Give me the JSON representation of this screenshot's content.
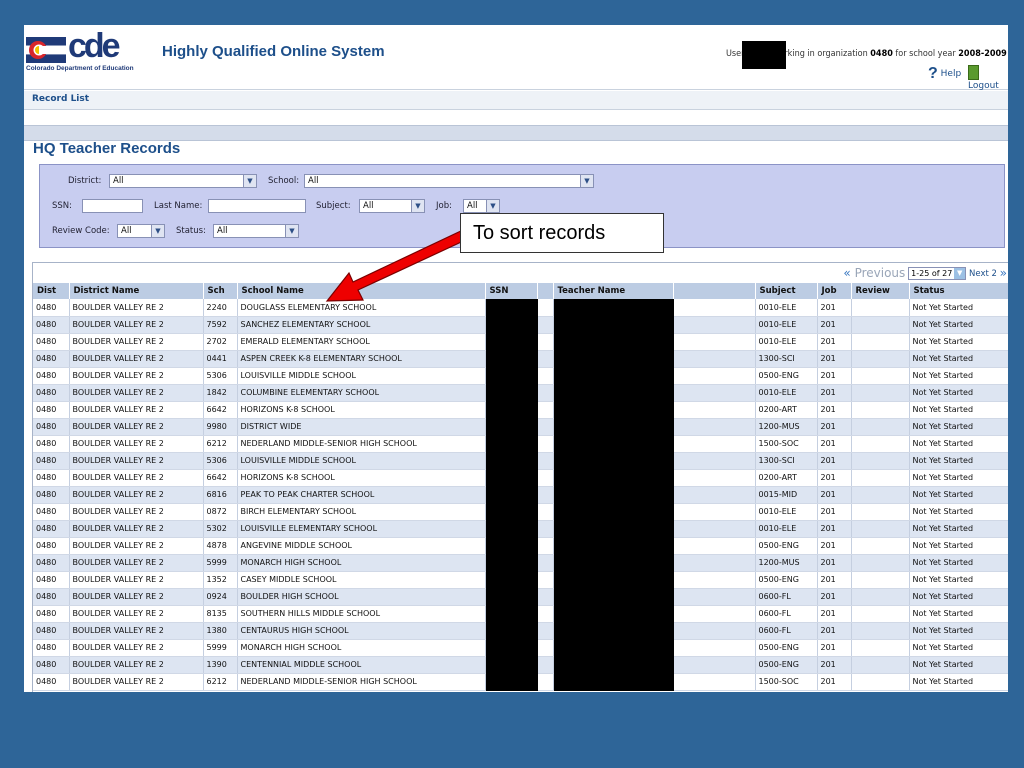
{
  "header": {
    "org_name": "Colorado Department of Education",
    "logo_text": "cde",
    "app_title": "Highly Qualified Online System",
    "user_prefix": "User",
    "user_mid": "working in organization",
    "org_code": "0480",
    "year_prefix": "for school year",
    "school_year": "2008-2009",
    "help": "Help",
    "logout": "Logout"
  },
  "nav": {
    "record_list": "Record List"
  },
  "page": {
    "title": "HQ Teacher Records"
  },
  "filters": {
    "district_label": "District:",
    "district_value": "All",
    "school_label": "School:",
    "school_value": "All",
    "ssn_label": "SSN:",
    "lastname_label": "Last Name:",
    "subject_label": "Subject:",
    "subject_value": "All",
    "job_label": "Job:",
    "job_value": "All",
    "review_label": "Review Code:",
    "review_value": "All",
    "status_label": "Status:",
    "status_value": "All"
  },
  "callout": {
    "text": "To sort records"
  },
  "pager": {
    "previous": "Previous",
    "range": "1-25 of 27",
    "next": "Next 2"
  },
  "table": {
    "columns": [
      "Dist",
      "District Name",
      "Sch",
      "School Name",
      "SSN",
      "",
      "Teacher Name",
      "",
      "Subject",
      "Job",
      "Review",
      "Status"
    ],
    "rows": [
      [
        "0480",
        "BOULDER VALLEY RE 2",
        "2240",
        "DOUGLASS ELEMENTARY SCHOOL",
        "0010-ELE",
        "201",
        "",
        "Not Yet Started"
      ],
      [
        "0480",
        "BOULDER VALLEY RE 2",
        "7592",
        "SANCHEZ ELEMENTARY SCHOOL",
        "0010-ELE",
        "201",
        "",
        "Not Yet Started"
      ],
      [
        "0480",
        "BOULDER VALLEY RE 2",
        "2702",
        "EMERALD ELEMENTARY SCHOOL",
        "0010-ELE",
        "201",
        "",
        "Not Yet Started"
      ],
      [
        "0480",
        "BOULDER VALLEY RE 2",
        "0441",
        "ASPEN CREEK K-8 ELEMENTARY SCHOOL",
        "1300-SCI",
        "201",
        "",
        "Not Yet Started"
      ],
      [
        "0480",
        "BOULDER VALLEY RE 2",
        "5306",
        "LOUISVILLE MIDDLE SCHOOL",
        "0500-ENG",
        "201",
        "",
        "Not Yet Started"
      ],
      [
        "0480",
        "BOULDER VALLEY RE 2",
        "1842",
        "COLUMBINE ELEMENTARY SCHOOL",
        "0010-ELE",
        "201",
        "",
        "Not Yet Started"
      ],
      [
        "0480",
        "BOULDER VALLEY RE 2",
        "6642",
        "HORIZONS K-8 SCHOOL",
        "0200-ART",
        "201",
        "",
        "Not Yet Started"
      ],
      [
        "0480",
        "BOULDER VALLEY RE 2",
        "9980",
        "DISTRICT WIDE",
        "1200-MUS",
        "201",
        "",
        "Not Yet Started"
      ],
      [
        "0480",
        "BOULDER VALLEY RE 2",
        "6212",
        "NEDERLAND MIDDLE-SENIOR HIGH SCHOOL",
        "1500-SOC",
        "201",
        "",
        "Not Yet Started"
      ],
      [
        "0480",
        "BOULDER VALLEY RE 2",
        "5306",
        "LOUISVILLE MIDDLE SCHOOL",
        "1300-SCI",
        "201",
        "",
        "Not Yet Started"
      ],
      [
        "0480",
        "BOULDER VALLEY RE 2",
        "6642",
        "HORIZONS K-8 SCHOOL",
        "0200-ART",
        "201",
        "",
        "Not Yet Started"
      ],
      [
        "0480",
        "BOULDER VALLEY RE 2",
        "6816",
        "PEAK TO PEAK CHARTER SCHOOL",
        "0015-MID",
        "201",
        "",
        "Not Yet Started"
      ],
      [
        "0480",
        "BOULDER VALLEY RE 2",
        "0872",
        "BIRCH ELEMENTARY SCHOOL",
        "0010-ELE",
        "201",
        "",
        "Not Yet Started"
      ],
      [
        "0480",
        "BOULDER VALLEY RE 2",
        "5302",
        "LOUISVILLE ELEMENTARY SCHOOL",
        "0010-ELE",
        "201",
        "",
        "Not Yet Started"
      ],
      [
        "0480",
        "BOULDER VALLEY RE 2",
        "4878",
        "ANGEVINE MIDDLE SCHOOL",
        "0500-ENG",
        "201",
        "",
        "Not Yet Started"
      ],
      [
        "0480",
        "BOULDER VALLEY RE 2",
        "5999",
        "MONARCH HIGH SCHOOL",
        "1200-MUS",
        "201",
        "",
        "Not Yet Started"
      ],
      [
        "0480",
        "BOULDER VALLEY RE 2",
        "1352",
        "CASEY MIDDLE SCHOOL",
        "0500-ENG",
        "201",
        "",
        "Not Yet Started"
      ],
      [
        "0480",
        "BOULDER VALLEY RE 2",
        "0924",
        "BOULDER HIGH SCHOOL",
        "0600-FL",
        "201",
        "",
        "Not Yet Started"
      ],
      [
        "0480",
        "BOULDER VALLEY RE 2",
        "8135",
        "SOUTHERN HILLS MIDDLE SCHOOL",
        "0600-FL",
        "201",
        "",
        "Not Yet Started"
      ],
      [
        "0480",
        "BOULDER VALLEY RE 2",
        "1380",
        "CENTAURUS HIGH SCHOOL",
        "0600-FL",
        "201",
        "",
        "Not Yet Started"
      ],
      [
        "0480",
        "BOULDER VALLEY RE 2",
        "5999",
        "MONARCH HIGH SCHOOL",
        "0500-ENG",
        "201",
        "",
        "Not Yet Started"
      ],
      [
        "0480",
        "BOULDER VALLEY RE 2",
        "1390",
        "CENTENNIAL MIDDLE SCHOOL",
        "0500-ENG",
        "201",
        "",
        "Not Yet Started"
      ],
      [
        "0480",
        "BOULDER VALLEY RE 2",
        "6212",
        "NEDERLAND MIDDLE-SENIOR HIGH SCHOOL",
        "1500-SOC",
        "201",
        "",
        "Not Yet Started"
      ]
    ]
  },
  "colors": {
    "page_bg": "#2e6598",
    "brand": "#1d4f8a",
    "row_alt": "#dde5f2",
    "header_row": "#bccce3",
    "filter_bg": "#c8cdf0",
    "arrow": "#ee0000"
  }
}
